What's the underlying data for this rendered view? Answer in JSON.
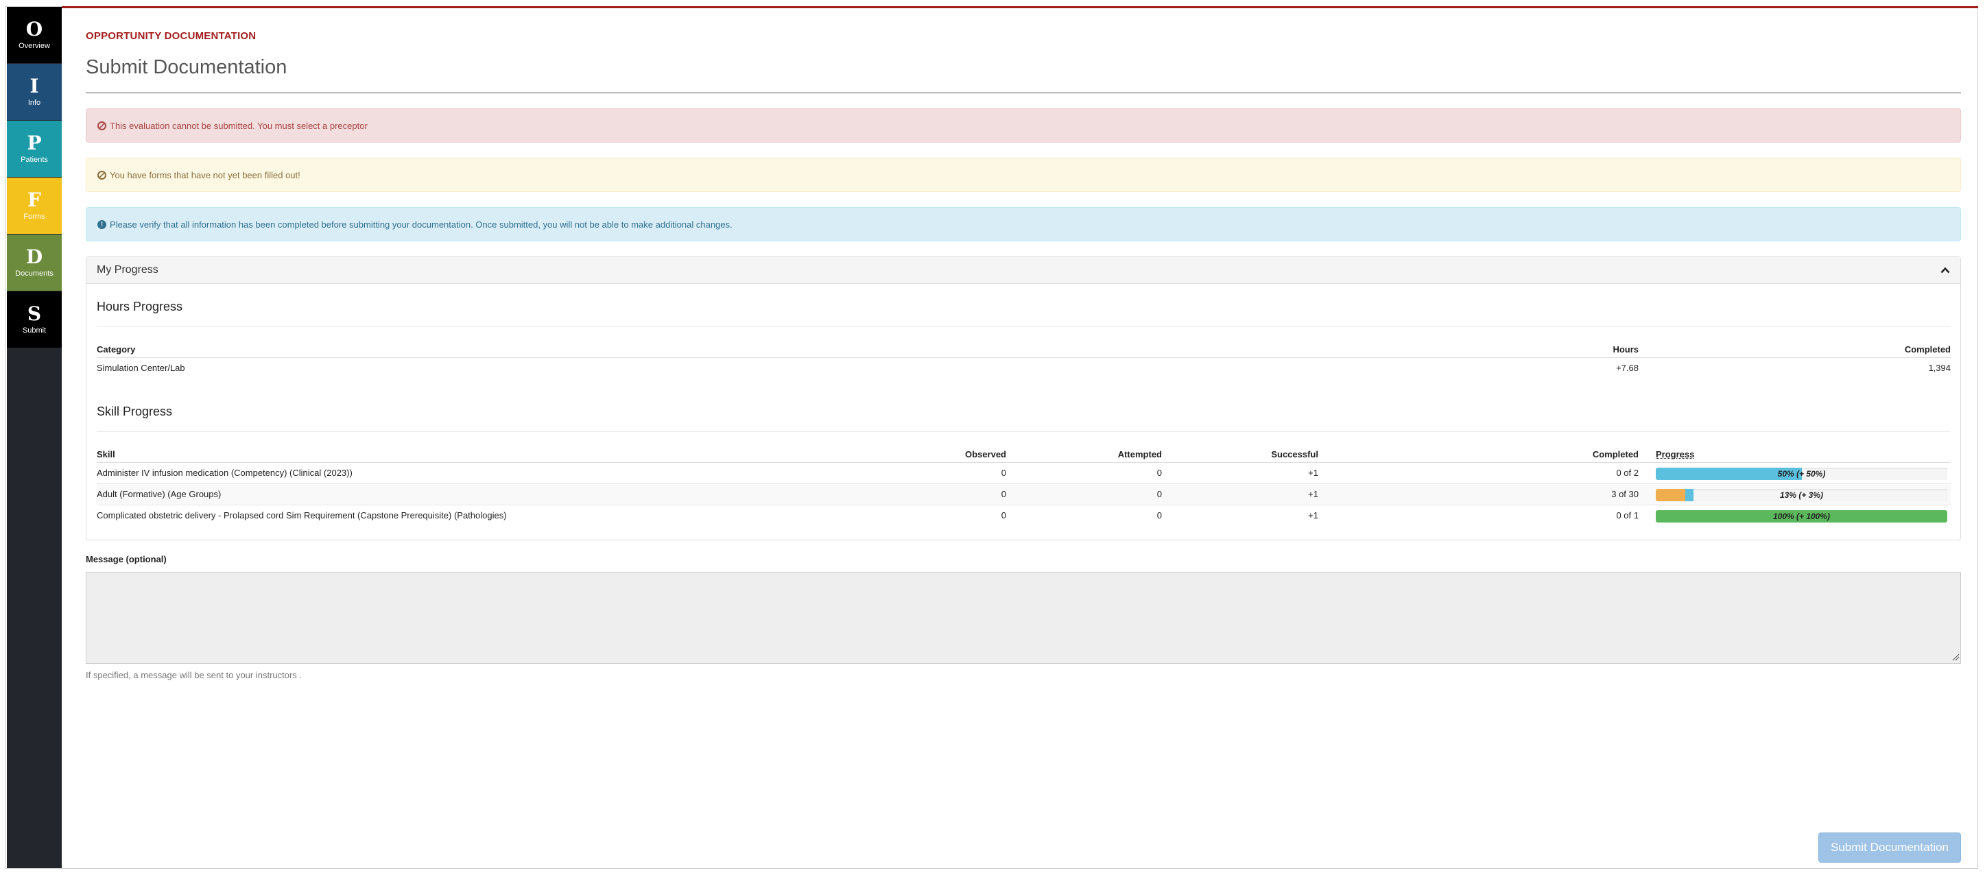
{
  "sidebar": {
    "items": [
      {
        "letter": "O",
        "label": "Overview",
        "color": "#000000"
      },
      {
        "letter": "I",
        "label": "Info",
        "color": "#1f4e79"
      },
      {
        "letter": "P",
        "label": "Patients",
        "color": "#1b9aa8"
      },
      {
        "letter": "F",
        "label": "Forms",
        "color": "#f4c21c"
      },
      {
        "letter": "D",
        "label": "Documents",
        "color": "#6c8b3c"
      },
      {
        "letter": "S",
        "label": "Submit",
        "color": "#000000"
      }
    ]
  },
  "header": {
    "eyebrow": "OPPORTUNITY DOCUMENTATION",
    "title": "Submit Documentation"
  },
  "alerts": {
    "danger": {
      "icon": "ban-icon",
      "text": "This evaluation cannot be submitted. You must select a preceptor"
    },
    "warning": {
      "icon": "ban-icon",
      "text": "You have forms that have not yet been filled out!"
    },
    "info": {
      "icon": "info-circle-icon",
      "text": "Please verify that all information has been completed before submitting your documentation. Once submitted, you will not be able to make additional changes."
    }
  },
  "progress_panel": {
    "heading": "My Progress",
    "collapse_icon": "chevron-up-icon",
    "hours": {
      "title": "Hours Progress",
      "columns": {
        "category": "Category",
        "hours": "Hours",
        "completed": "Completed"
      },
      "rows": [
        {
          "category": "Simulation Center/Lab",
          "hours": "+7.68",
          "completed": "1,394"
        }
      ]
    },
    "skills": {
      "title": "Skill Progress",
      "columns": {
        "skill": "Skill",
        "observed": "Observed",
        "attempted": "Attempted",
        "successful": "Successful",
        "completed": "Completed",
        "progress": "Progress"
      },
      "rows": [
        {
          "skill": "Administer IV infusion medication (Competency) (Clinical (2023))",
          "observed": "0",
          "attempted": "0",
          "successful": "+1",
          "completed": "0 of 2",
          "progress_text": "50% (+ 50%)",
          "segments": [
            {
              "value": 50,
              "color": "#5bc0de"
            }
          ]
        },
        {
          "skill": "Adult (Formative) (Age Groups)",
          "observed": "0",
          "attempted": "0",
          "successful": "+1",
          "completed": "3 of 30",
          "progress_text": "13% (+ 3%)",
          "segments": [
            {
              "value": 10,
              "color": "#f0ad4e"
            },
            {
              "value": 3,
              "color": "#5bc0de"
            }
          ]
        },
        {
          "skill": "Complicated obstetric delivery - Prolapsed cord Sim Requirement (Capstone Prerequisite) (Pathologies)",
          "observed": "0",
          "attempted": "0",
          "successful": "+1",
          "completed": "0 of 1",
          "progress_text": "100% (+ 100%)",
          "segments": [
            {
              "value": 100,
              "color": "#5cb85c"
            }
          ]
        }
      ]
    }
  },
  "message": {
    "label": "Message (optional)",
    "value": "",
    "help": "If specified, a message will be sent to your instructors ."
  },
  "submit": {
    "label": "Submit Documentation"
  }
}
